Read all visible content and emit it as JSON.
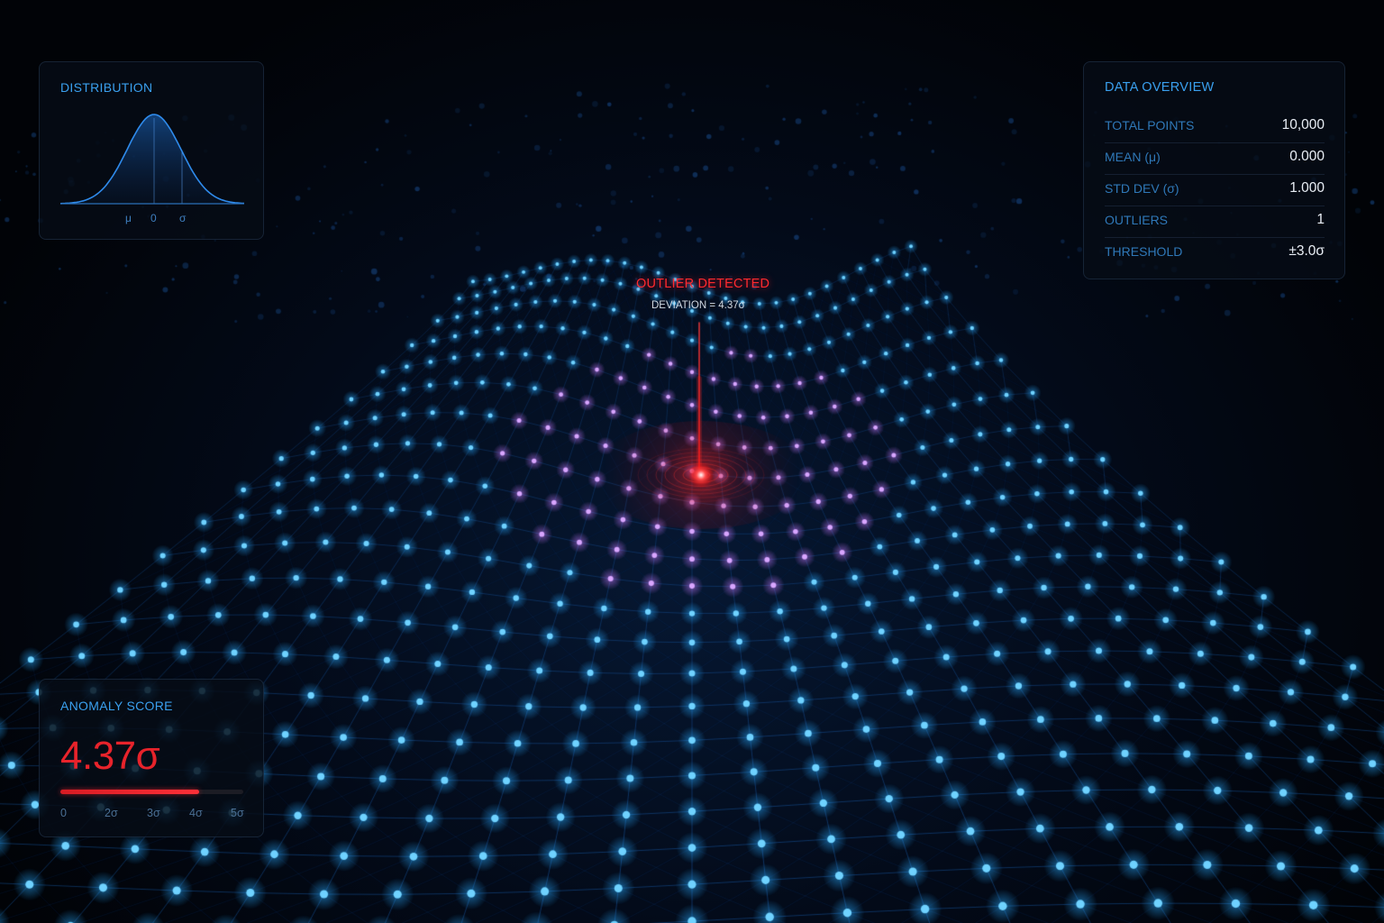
{
  "distribution": {
    "title": "DISTRIBUTION",
    "axis_labels": [
      "μ",
      "0",
      "σ"
    ]
  },
  "overview": {
    "title": "DATA OVERVIEW",
    "rows": [
      {
        "label": "TOTAL POINTS",
        "value": "10,000"
      },
      {
        "label": "MEAN (μ)",
        "value": "0.000"
      },
      {
        "label": "STD DEV (σ)",
        "value": "1.000"
      },
      {
        "label": "OUTLIERS",
        "value": "1"
      },
      {
        "label": "THRESHOLD",
        "value": "±3.0σ"
      }
    ]
  },
  "outlier": {
    "title": "OUTLIER DETECTED",
    "deviation": "DEVIATION = 4.37σ"
  },
  "anomaly": {
    "title": "ANOMALY SCORE",
    "value": "4.37σ",
    "score_fraction": 0.76,
    "ticks": [
      "0",
      "2σ",
      "3σ",
      "4σ",
      "5σ"
    ]
  },
  "colors": {
    "accent": "#3aa0ef",
    "node": "#1aa6ff",
    "alert": "#e8232b",
    "background": "#010307"
  }
}
